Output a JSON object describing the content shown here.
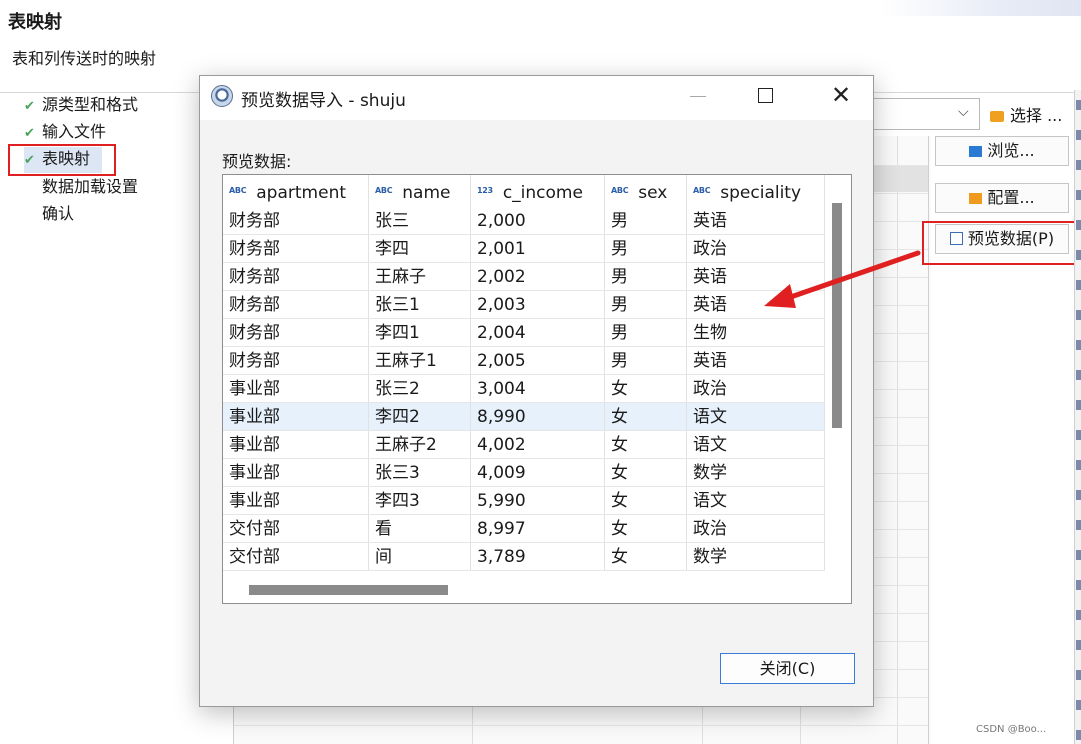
{
  "wizard": {
    "title": "表映射",
    "subtitle": "表和列传送时的映射",
    "steps": [
      {
        "label": "源类型和格式",
        "done": true
      },
      {
        "label": "输入文件",
        "done": true
      },
      {
        "label": "表映射",
        "done": true,
        "current": true
      },
      {
        "label": "数据加载设置",
        "done": false
      },
      {
        "label": "确认",
        "done": false
      }
    ],
    "select_button": "选择 ...",
    "browse_button": "浏览...",
    "config_button": "配置...",
    "preview_button": "预览数据(P)",
    "watermark": "CSDN @Boo..."
  },
  "dialog": {
    "title": "预览数据导入 - shuju",
    "preview_label": "预览数据:",
    "close_button": "关闭(C)",
    "columns": [
      {
        "icon": "ABC",
        "name": "apartment"
      },
      {
        "icon": "ABC",
        "name": "name"
      },
      {
        "icon": "123",
        "name": "c_income"
      },
      {
        "icon": "ABC",
        "name": "sex"
      },
      {
        "icon": "ABC",
        "name": "speciality"
      }
    ],
    "rows": [
      [
        "财务部",
        "张三",
        "2,000",
        "男",
        "英语"
      ],
      [
        "财务部",
        "李四",
        "2,001",
        "男",
        "政治"
      ],
      [
        "财务部",
        "王麻子",
        "2,002",
        "男",
        "英语"
      ],
      [
        "财务部",
        "张三1",
        "2,003",
        "男",
        "英语"
      ],
      [
        "财务部",
        "李四1",
        "2,004",
        "男",
        "生物"
      ],
      [
        "财务部",
        "王麻子1",
        "2,005",
        "男",
        "英语"
      ],
      [
        "事业部",
        "张三2",
        "3,004",
        "女",
        "政治"
      ],
      [
        "事业部",
        "李四2",
        "8,990",
        "女",
        "语文"
      ],
      [
        "事业部",
        "王麻子2",
        "4,002",
        "女",
        "语文"
      ],
      [
        "事业部",
        "张三3",
        "4,009",
        "女",
        "数学"
      ],
      [
        "事业部",
        "李四3",
        "5,990",
        "女",
        "语文"
      ],
      [
        "交付部",
        "看",
        "8,997",
        "女",
        "政治"
      ],
      [
        "交付部",
        "间",
        "3,789",
        "女",
        "数学"
      ]
    ],
    "selected_row": 7
  },
  "colors": {
    "highlight_red": "#e02020",
    "selection": "#e6f1fb",
    "accent_blue": "#3a7bd5",
    "check_green": "#4aa45a"
  }
}
